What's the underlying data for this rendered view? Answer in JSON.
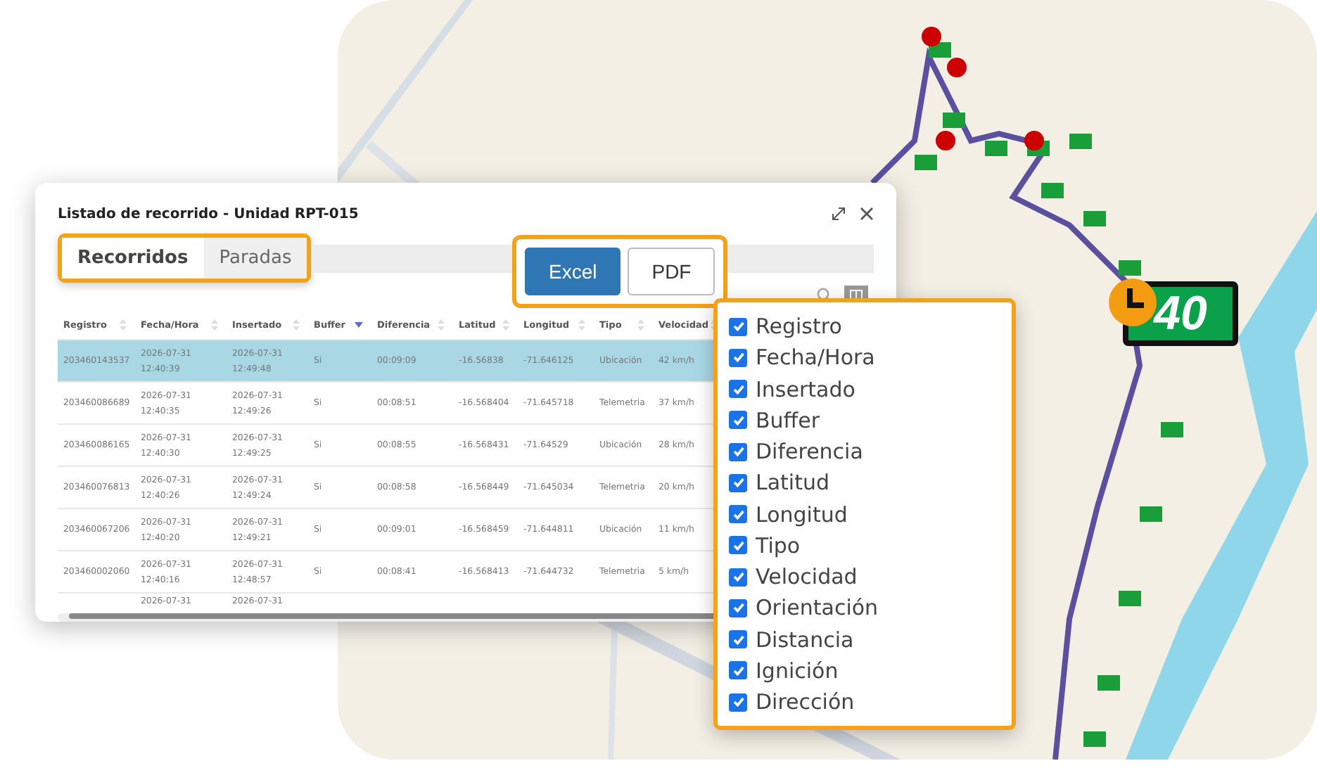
{
  "dialog": {
    "title": "Listado de recorrido - Unidad RPT-015"
  },
  "tabs": [
    {
      "label": "Recorridos",
      "selected": true
    },
    {
      "label": "Paradas",
      "selected": false
    }
  ],
  "export_buttons": [
    {
      "label": "Excel",
      "kind": "primary"
    },
    {
      "label": "PDF",
      "kind": "outline"
    }
  ],
  "table": {
    "columns": [
      {
        "label": "Registro",
        "sorted": false
      },
      {
        "label": "Fecha/Hora",
        "sorted": false
      },
      {
        "label": "Insertado",
        "sorted": false
      },
      {
        "label": "Buffer",
        "sorted": true
      },
      {
        "label": "Diferencia",
        "sorted": false
      },
      {
        "label": "Latitud",
        "sorted": false
      },
      {
        "label": "Longitud",
        "sorted": false
      },
      {
        "label": "Tipo",
        "sorted": false
      },
      {
        "label": "Velocidad",
        "sorted": false
      }
    ],
    "rows": [
      {
        "selected": true,
        "cells": [
          "203460143537",
          [
            "2026-07-31",
            "12:40:39"
          ],
          [
            "2026-07-31",
            "12:49:48"
          ],
          "Si",
          "00:09:09",
          "-16.56838",
          "-71.646125",
          "Ubicación",
          "42 km/h"
        ]
      },
      {
        "selected": false,
        "cells": [
          "203460086689",
          [
            "2026-07-31",
            "12:40:35"
          ],
          [
            "2026-07-31",
            "12:49:26"
          ],
          "Si",
          "00:08:51",
          "-16.568404",
          "-71.645718",
          "Telemetria",
          "37 km/h"
        ]
      },
      {
        "selected": false,
        "cells": [
          "203460086165",
          [
            "2026-07-31",
            "12:40:30"
          ],
          [
            "2026-07-31",
            "12:49:25"
          ],
          "Si",
          "00:08:55",
          "-16.568431",
          "-71.64529",
          "Ubicación",
          "28 km/h"
        ]
      },
      {
        "selected": false,
        "cells": [
          "203460076813",
          [
            "2026-07-31",
            "12:40:26"
          ],
          [
            "2026-07-31",
            "12:49:24"
          ],
          "Si",
          "00:08:58",
          "-16.568449",
          "-71.645034",
          "Telemetria",
          "20 km/h"
        ]
      },
      {
        "selected": false,
        "cells": [
          "203460067206",
          [
            "2026-07-31",
            "12:40:20"
          ],
          [
            "2026-07-31",
            "12:49:21"
          ],
          "Si",
          "00:09:01",
          "-16.568459",
          "-71.644811",
          "Ubicación",
          "11 km/h"
        ]
      },
      {
        "selected": false,
        "cells": [
          "203460002060",
          [
            "2026-07-31",
            "12:40:16"
          ],
          [
            "2026-07-31",
            "12:48:57"
          ],
          "Si",
          "00:08:41",
          "-16.568413",
          "-71.644732",
          "Telemetria",
          "5 km/h"
        ]
      },
      {
        "selected": false,
        "cells": [
          null,
          [
            "2026-07-31"
          ],
          [
            "2026-07-31"
          ],
          null,
          null,
          null,
          null,
          null,
          null
        ]
      }
    ]
  },
  "column_chooser": [
    {
      "label": "Registro",
      "checked": true
    },
    {
      "label": "Fecha/Hora",
      "checked": true
    },
    {
      "label": "Insertado",
      "checked": true
    },
    {
      "label": "Buffer",
      "checked": true
    },
    {
      "label": "Diferencia",
      "checked": true
    },
    {
      "label": "Latitud",
      "checked": true
    },
    {
      "label": "Longitud",
      "checked": true
    },
    {
      "label": "Tipo",
      "checked": true
    },
    {
      "label": "Velocidad",
      "checked": true
    },
    {
      "label": "Orientación",
      "checked": true
    },
    {
      "label": "Distancia",
      "checked": true
    },
    {
      "label": "Ignición",
      "checked": true
    },
    {
      "label": "Dirección",
      "checked": true
    }
  ],
  "speed_marker": "40"
}
